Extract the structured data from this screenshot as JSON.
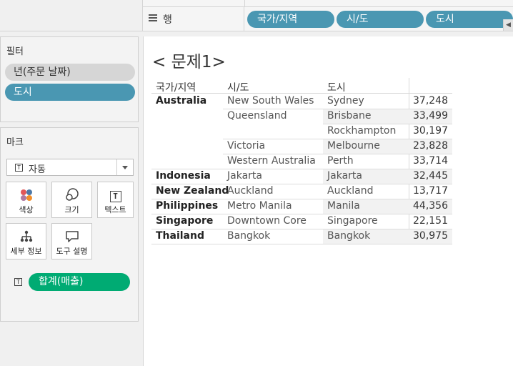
{
  "shelves": {
    "rows_label": "행",
    "row_pills": [
      "국가/지역",
      "시/도",
      "도시"
    ]
  },
  "filters": {
    "title": "필터",
    "items": [
      "년(주문 날짜)",
      "도시"
    ]
  },
  "marks": {
    "title": "마크",
    "mark_type": "자동",
    "buttons": {
      "color": "색상",
      "size": "크기",
      "text": "텍스트",
      "detail": "세부 정보",
      "tooltip": "도구 설명"
    },
    "measure_pill": "합계(매출)"
  },
  "view": {
    "title": "< 문제1>",
    "headers": {
      "country": "국가/지역",
      "state": "시/도",
      "city": "도시"
    },
    "rows": [
      {
        "country": "Australia",
        "state": "New South Wales",
        "city": "Sydney",
        "value": "37,248"
      },
      {
        "country": "",
        "state": "Queensland",
        "city": "Brisbane",
        "value": "33,499"
      },
      {
        "country": "",
        "state": "",
        "city": "Rockhampton",
        "value": "30,197"
      },
      {
        "country": "",
        "state": "Victoria",
        "city": "Melbourne",
        "value": "23,828"
      },
      {
        "country": "",
        "state": "Western Australia",
        "city": "Perth",
        "value": "33,714"
      },
      {
        "country": "Indonesia",
        "state": "Jakarta",
        "city": "Jakarta",
        "value": "32,445"
      },
      {
        "country": "New Zealand",
        "state": "Auckland",
        "city": "Auckland",
        "value": "13,717"
      },
      {
        "country": "Philippines",
        "state": "Metro Manila",
        "city": "Manila",
        "value": "44,356"
      },
      {
        "country": "Singapore",
        "state": "Downtown Core",
        "city": "Singapore",
        "value": "22,151"
      },
      {
        "country": "Thailand",
        "state": "Bangkok",
        "city": "Bangkok",
        "value": "30,975"
      }
    ]
  },
  "colors": {
    "dimension_pill": "#4a97b2",
    "measure_pill": "#00ab73",
    "filter_pill_gray": "#d6d6d6"
  }
}
